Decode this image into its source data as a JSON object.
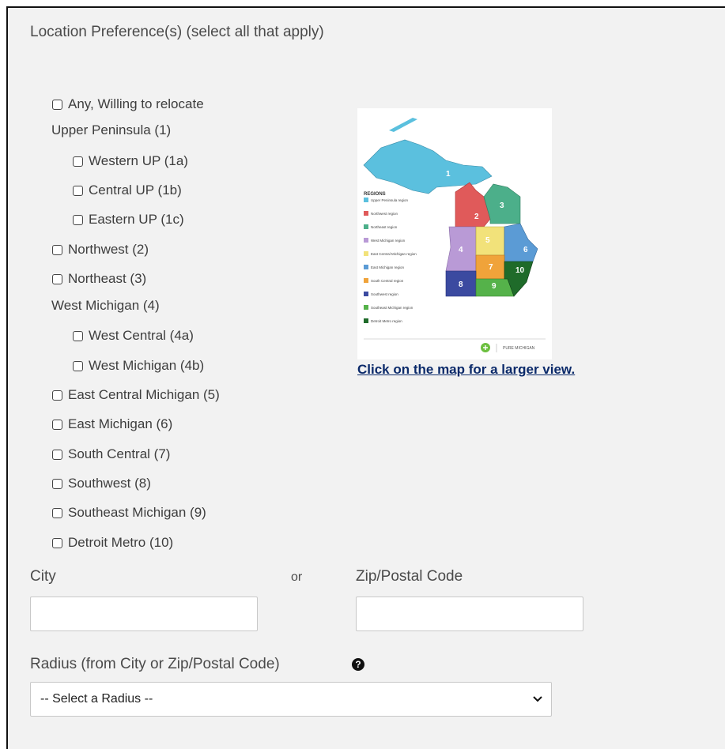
{
  "location": {
    "legend": "Location Preference(s) (select all that apply)",
    "options": [
      {
        "label": "Any, Willing to relocate"
      },
      {
        "label": "Western UP (1a)"
      },
      {
        "label": "Central UP (1b)"
      },
      {
        "label": "Eastern UP (1c)"
      },
      {
        "label": "Northwest (2)"
      },
      {
        "label": "Northeast (3)"
      },
      {
        "label": "West Central (4a)"
      },
      {
        "label": "West Michigan (4b)"
      },
      {
        "label": "East Central Michigan (5)"
      },
      {
        "label": "East Michigan (6)"
      },
      {
        "label": "South Central (7)"
      },
      {
        "label": "Southwest (8)"
      },
      {
        "label": "Southeast Michigan (9)"
      },
      {
        "label": "Detroit Metro (10)"
      }
    ],
    "groups": {
      "upper_peninsula": "Upper Peninsula (1)",
      "west_michigan": "West Michigan (4)"
    },
    "map": {
      "link_text": "Click on the map for a larger view.",
      "legend_title": "REGIONS",
      "legend_items": [
        {
          "num": "1",
          "text": "Upper Peninsula region",
          "color": "#5bc0de"
        },
        {
          "num": "2",
          "text": "Northwest region",
          "color": "#e05a5a"
        },
        {
          "num": "3",
          "text": "Northeast region",
          "color": "#4caf8a"
        },
        {
          "num": "4",
          "text": "West Michigan region",
          "color": "#b99ad6"
        },
        {
          "num": "5",
          "text": "East Central Michigan region",
          "color": "#f2e27a"
        },
        {
          "num": "6",
          "text": "East Michigan region",
          "color": "#5b9bd5"
        },
        {
          "num": "7",
          "text": "South Central region",
          "color": "#f0a33a"
        },
        {
          "num": "8",
          "text": "Southwest region",
          "color": "#3b4aa0"
        },
        {
          "num": "9",
          "text": "Southeast Michigan region",
          "color": "#55b24a"
        },
        {
          "num": "10",
          "text": "Detroit Metro region",
          "color": "#1f6b2a"
        }
      ],
      "logo_text": "PURE MICHIGAN"
    }
  },
  "city": {
    "label": "City",
    "value": ""
  },
  "or_text": "or",
  "zip": {
    "label": "Zip/Postal Code",
    "value": ""
  },
  "radius": {
    "label": "Radius (from City or Zip/Postal Code)",
    "help_icon": "question-circle-icon",
    "selected": "-- Select a Radius --"
  }
}
